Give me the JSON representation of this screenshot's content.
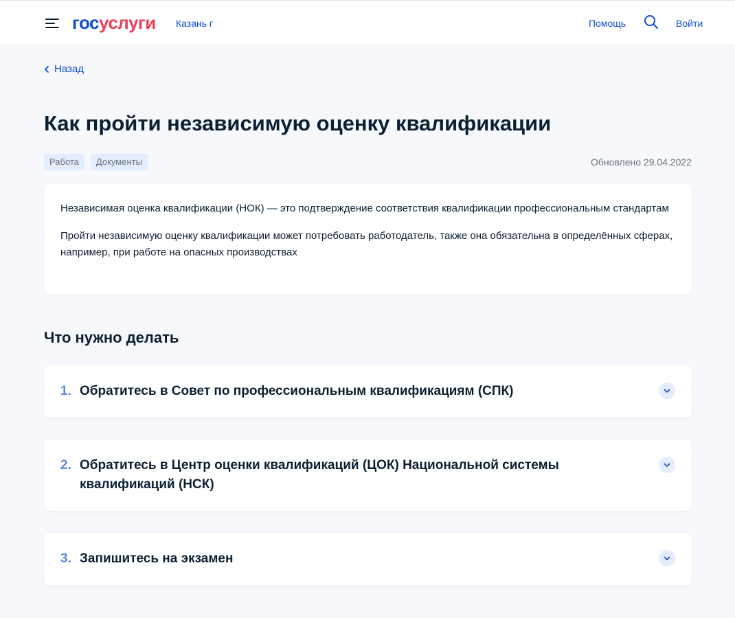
{
  "header": {
    "logo_part1": "гос",
    "logo_part2": "услуги",
    "city": "Казань г",
    "help": "Помощь",
    "login": "Войти"
  },
  "nav": {
    "back": "Назад"
  },
  "page": {
    "title": "Как пройти независимую оценку квалификации",
    "tags": [
      "Работа",
      "Документы"
    ],
    "updated": "Обновлено 29.04.2022"
  },
  "intro": {
    "p1": "Независимая оценка квалификации (НОК) — это подтверждение соответствия квалификации профессиональным стандартам",
    "p2": "Пройти независимую оценку квалификации может потребовать работодатель, также она обязательна в определённых сферах, например, при работе на опасных производствах"
  },
  "steps_section": {
    "title": "Что нужно делать",
    "steps": [
      {
        "num": "1.",
        "text": "Обратитесь в Совет по профессиональным квалификациям (СПК)"
      },
      {
        "num": "2.",
        "text": "Обратитесь в Центр оценки квалификаций (ЦОК) Национальной системы квалификаций (НСК)"
      },
      {
        "num": "3.",
        "text": "Запишитесь на экзамен"
      }
    ]
  },
  "colors": {
    "brand_blue": "#0d4cd3",
    "brand_red": "#ee3f58",
    "step_num": "#5e88d8"
  },
  "icons": {
    "menu": "burger-icon",
    "search": "search-icon",
    "back": "chevron-left-icon",
    "expand": "chevron-down-icon"
  }
}
